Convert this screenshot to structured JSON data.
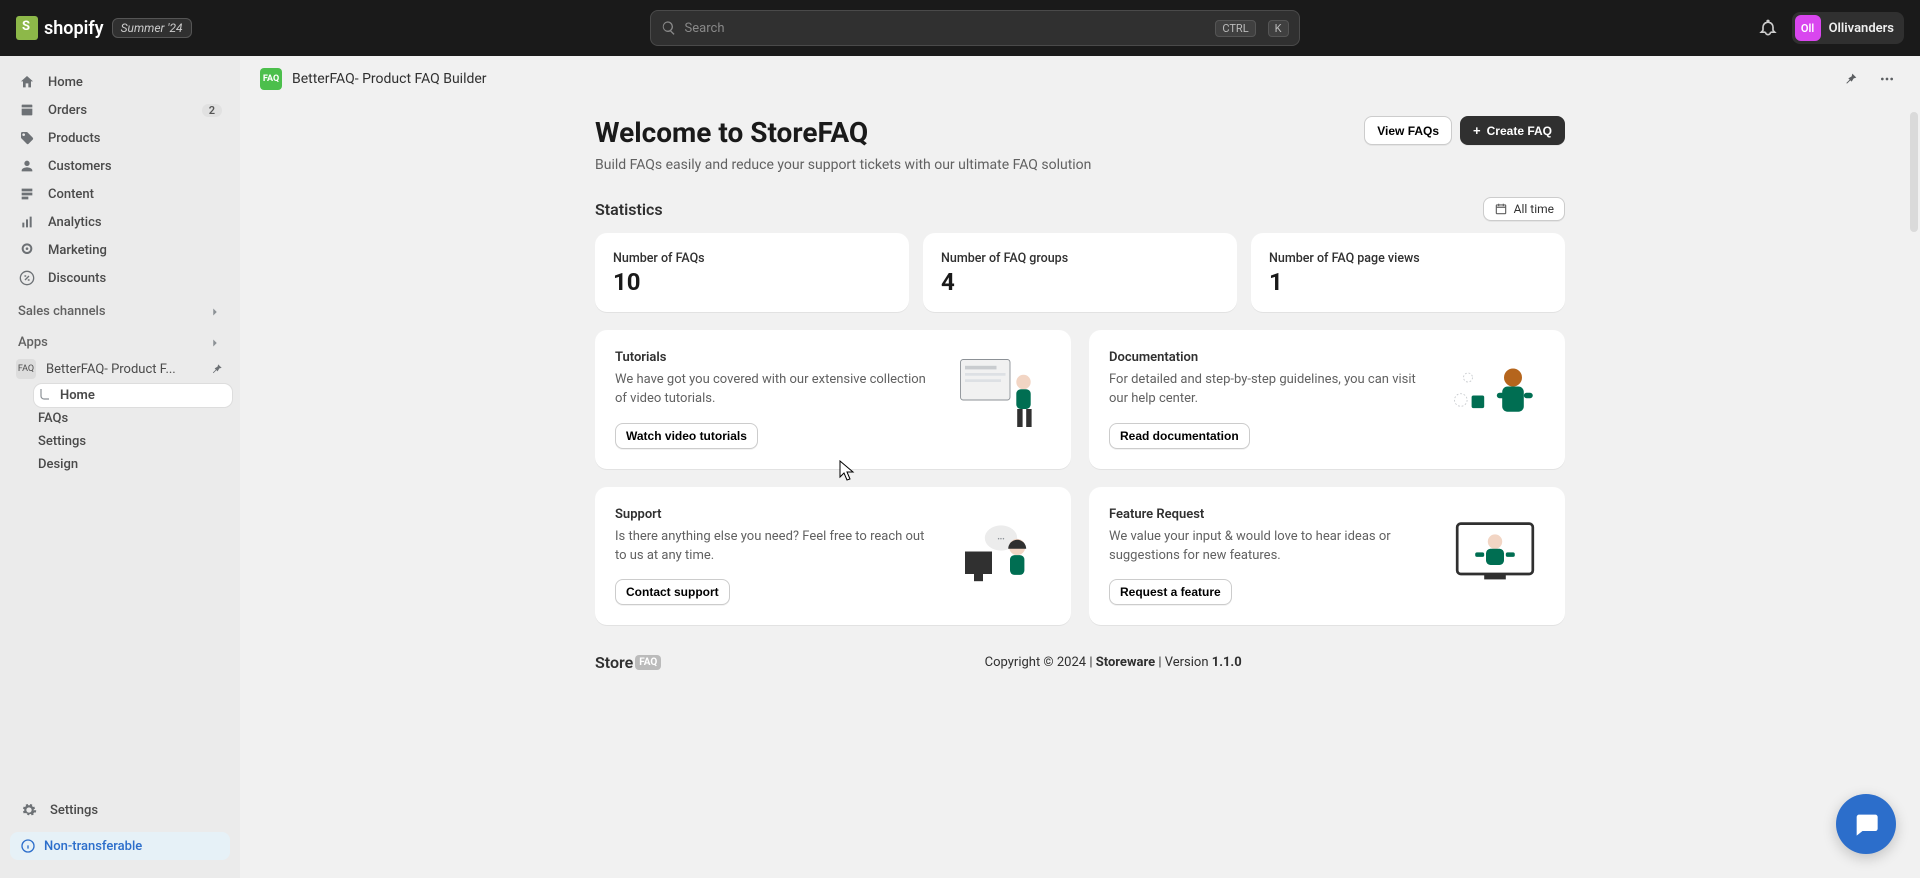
{
  "top": {
    "brand": "shopify",
    "summer_tag": "Summer '24",
    "search_placeholder": "Search",
    "shortcut_ctrl": "CTRL",
    "shortcut_k": "K",
    "avatar_initials": "Oll",
    "store_name": "Ollivanders"
  },
  "sidebar": {
    "home": "Home",
    "orders": "Orders",
    "orders_badge": "2",
    "products": "Products",
    "customers": "Customers",
    "content": "Content",
    "analytics": "Analytics",
    "marketing": "Marketing",
    "discounts": "Discounts",
    "sales_channels": "Sales channels",
    "apps": "Apps",
    "app_item": "BetterFAQ- Product F...",
    "app_sub_home": "Home",
    "app_sub_faqs": "FAQs",
    "app_sub_settings": "Settings",
    "app_sub_design": "Design",
    "settings": "Settings",
    "non_transferable": "Non-transferable"
  },
  "app_header": {
    "name": "BetterFAQ- Product FAQ Builder"
  },
  "welcome": {
    "title": "Welcome to StoreFAQ",
    "subtitle": "Build FAQs easily and reduce your support tickets with our ultimate FAQ solution",
    "view_btn": "View FAQs",
    "create_btn": "Create FAQ"
  },
  "stats_header": {
    "title": "Statistics",
    "filter": "All time"
  },
  "stats": [
    {
      "label": "Number of FAQs",
      "value": "10"
    },
    {
      "label": "Number of FAQ groups",
      "value": "4"
    },
    {
      "label": "Number of FAQ page views",
      "value": "1"
    }
  ],
  "cards": {
    "tutorials": {
      "title": "Tutorials",
      "body": "We have got you covered with our extensive collection of video tutorials.",
      "cta": "Watch video tutorials"
    },
    "docs": {
      "title": "Documentation",
      "body": "For detailed and step-by-step guidelines, you can visit our help center.",
      "cta": "Read documentation"
    },
    "support": {
      "title": "Support",
      "body": "Is there anything else you need? Feel free to reach out to us at any time.",
      "cta": "Contact support"
    },
    "feature": {
      "title": "Feature Request",
      "body": "We value your input & would love to hear ideas or suggestions for new features.",
      "cta": "Request a feature"
    }
  },
  "footer": {
    "brand_left": "Store",
    "brand_right": "FAQ",
    "copyright_prefix": "Copyright © 2024 | ",
    "company": "Storeware",
    "version_prefix": " | Version ",
    "version": "1.1.0"
  }
}
